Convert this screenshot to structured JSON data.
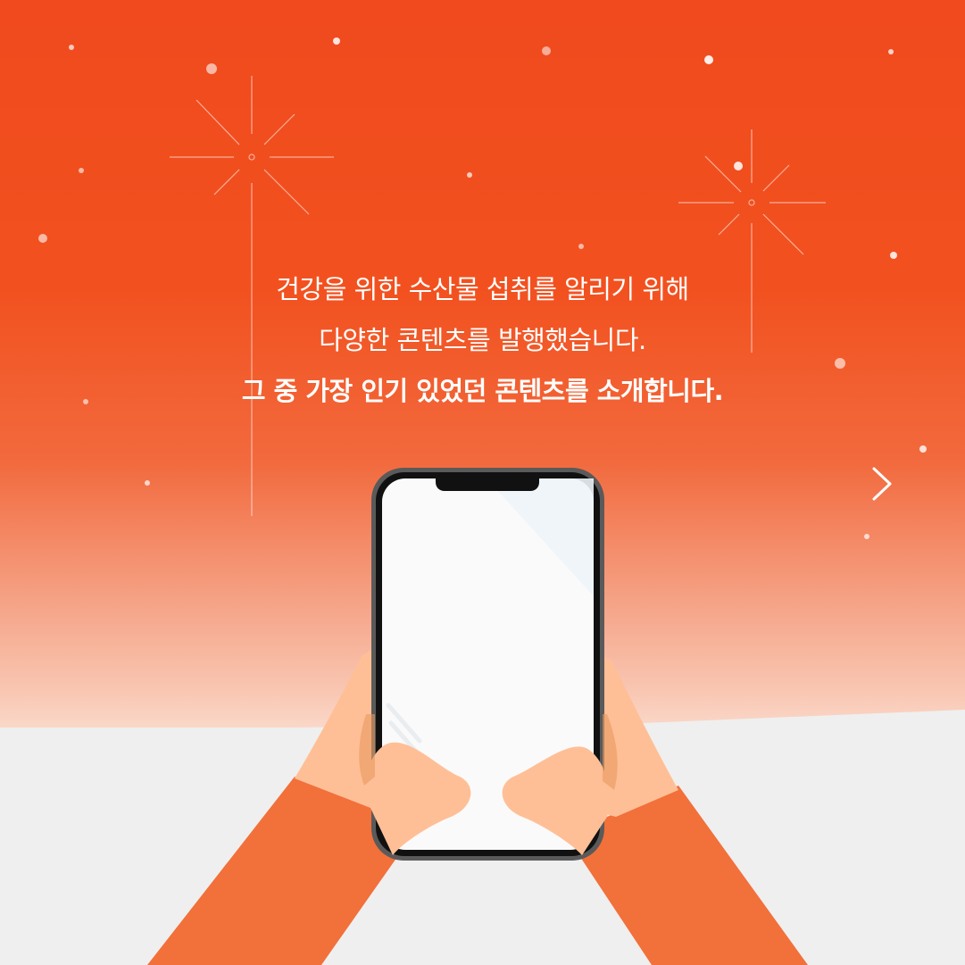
{
  "headline": {
    "line1": "건강을 위한 수산물 섭취를 알리기 위해",
    "line2": "다양한 콘텐츠를 발행했습니다.",
    "line3": "그 중 가장 인기 있었던 콘텐츠를 소개합니다."
  },
  "navigation": {
    "next_icon": "chevron-right-icon"
  },
  "colors": {
    "background_top": "#f04a1e",
    "background_mid": "#f26a3e",
    "background_fade": "#fbe3d8",
    "floor": "#efefef",
    "text": "#ffffff",
    "sleeve": "#f2703a",
    "skin": "#ffbf96",
    "phone_frame": "#3b3b3b",
    "screen": "#fafafa"
  }
}
